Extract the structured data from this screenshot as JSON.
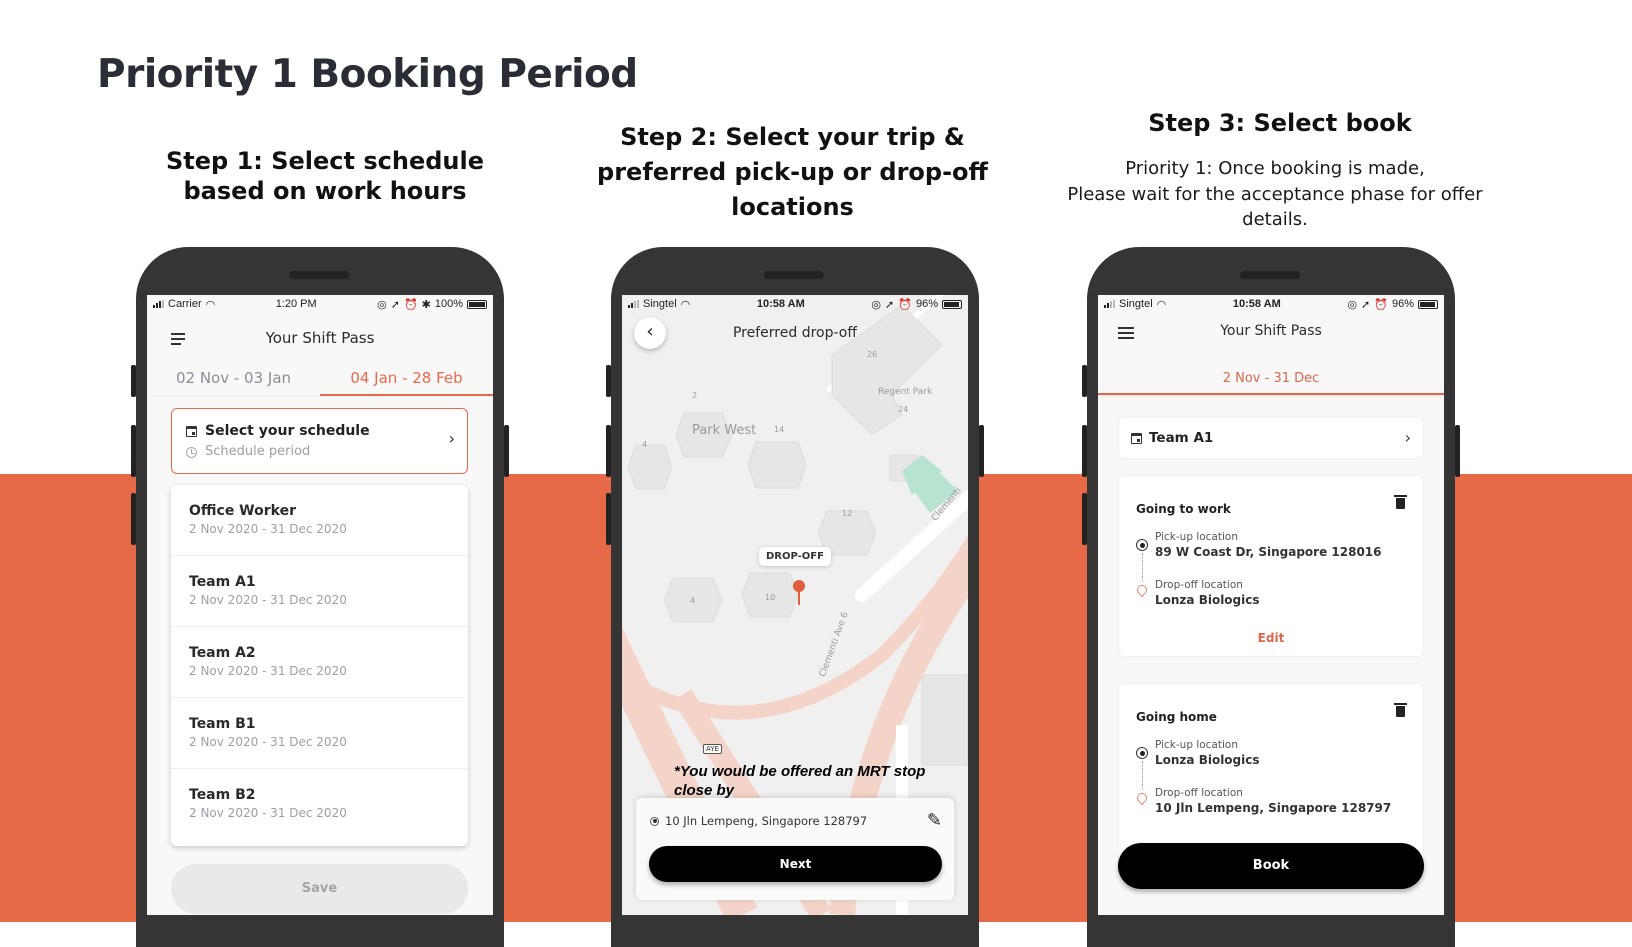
{
  "page": {
    "title": "Priority 1 Booking Period",
    "accent_color": "#e76a48"
  },
  "steps": [
    {
      "title": "Step 1: Select schedule based on work hours"
    },
    {
      "title": "Step 2: Select your trip & preferred pick-up or drop-off locations"
    },
    {
      "title": "Step 3: Select book",
      "description_line1": "Priority 1: Once booking is made,",
      "description_line2": "Please wait for the acceptance phase for offer details."
    }
  ],
  "phone1": {
    "status": {
      "carrier": "Carrier",
      "time": "1:20 PM",
      "battery": "100%"
    },
    "app_title": "Your Shift Pass",
    "tabs": [
      {
        "label": "02 Nov - 03 Jan",
        "active": false
      },
      {
        "label": "04 Jan - 28 Feb",
        "active": true
      }
    ],
    "schedule_card": {
      "title": "Select your schedule",
      "subtitle": "Schedule period",
      "chevron": "›"
    },
    "schedules": [
      {
        "name": "Office Worker",
        "dates": "2 Nov 2020 - 31 Dec 2020"
      },
      {
        "name": "Team A1",
        "dates": "2 Nov 2020 - 31 Dec 2020"
      },
      {
        "name": "Team A2",
        "dates": "2 Nov 2020 - 31 Dec 2020"
      },
      {
        "name": "Team B1",
        "dates": "2 Nov 2020 - 31 Dec 2020"
      },
      {
        "name": "Team B2",
        "dates": "2 Nov 2020 - 31 Dec 2020"
      }
    ],
    "save_label": "Save"
  },
  "phone2": {
    "status": {
      "carrier": "Singtel",
      "time": "10:58 AM",
      "battery": "96%"
    },
    "app_title": "Preferred drop-off",
    "back_icon": "‹",
    "map_labels": {
      "park_west": "Park West",
      "regent_park": "Regent Park",
      "b2": "2",
      "b4": "4",
      "b14": "14",
      "b26": "26",
      "b24": "24",
      "b12": "12",
      "b10": "10",
      "b4b": "4",
      "road1": "Clementi Ave 6",
      "road2": "Clementi",
      "aye": "AYE"
    },
    "dropoff_tag": "DROP-OFF",
    "mrt_note": "*You would be offered an MRT stop close by",
    "address": "10 Jln Lempeng, Singapore 128797",
    "edit_icon": "✎",
    "next_label": "Next"
  },
  "phone3": {
    "status": {
      "carrier": "Singtel",
      "time": "10:58 AM",
      "battery": "96%"
    },
    "app_title": "Your Shift Pass",
    "tab_label": "2 Nov - 31 Dec",
    "team": {
      "label": "Team A1",
      "chevron": "›"
    },
    "trips": [
      {
        "title": "Going to work",
        "pickup_label": "Pick-up location",
        "pickup_value": "89 W Coast Dr, Singapore 128016",
        "dropoff_label": "Drop-off location",
        "dropoff_value": "Lonza Biologics",
        "edit_label": "Edit"
      },
      {
        "title": "Going home",
        "pickup_label": "Pick-up location",
        "pickup_value": "Lonza Biologics",
        "dropoff_label": "Drop-off location",
        "dropoff_value": "10 Jln Lempeng, Singapore 128797"
      }
    ],
    "book_label": "Book"
  }
}
